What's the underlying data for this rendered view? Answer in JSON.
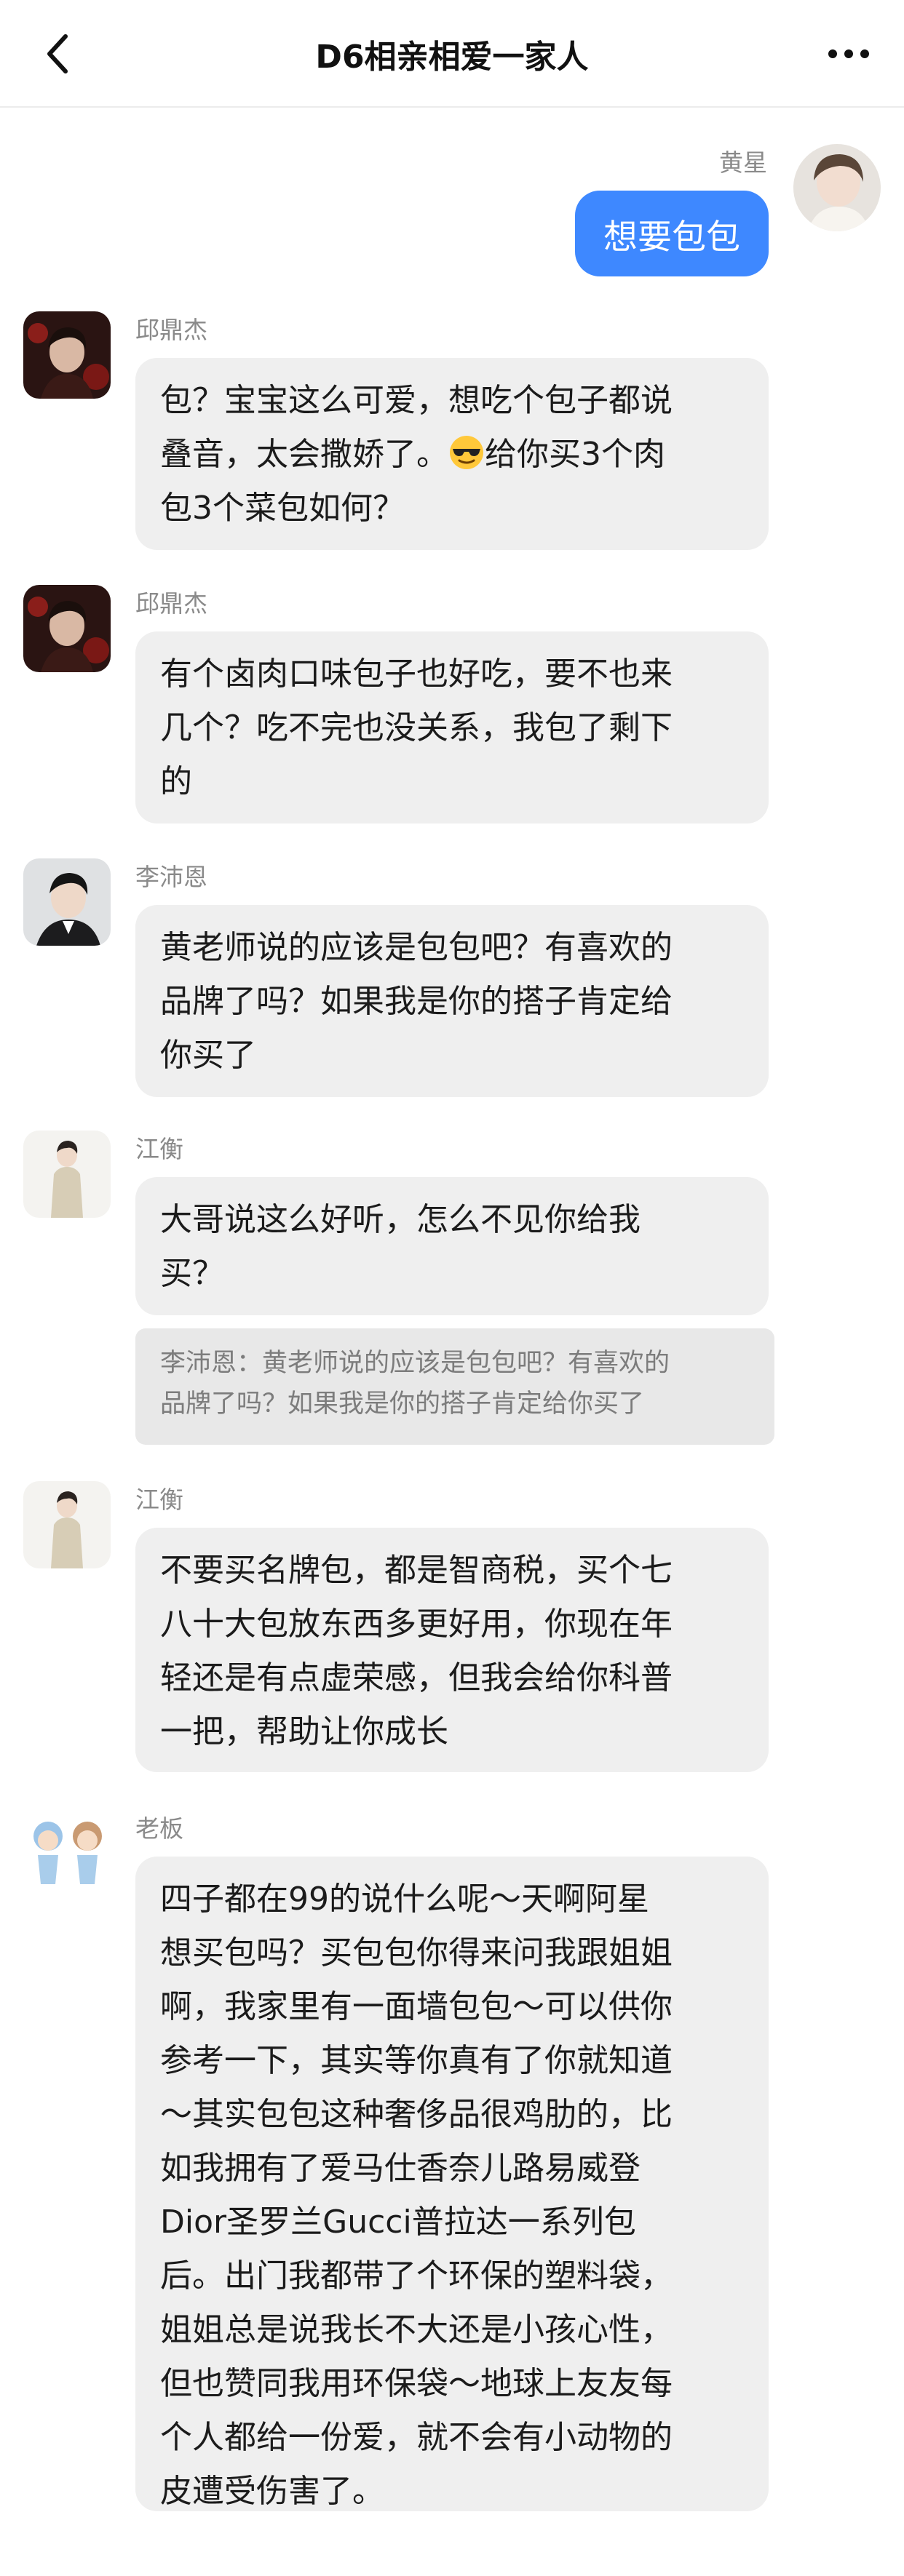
{
  "header": {
    "title": "D6相亲相爱一家人"
  },
  "messages": {
    "self": {
      "name": "黄星",
      "text": "想要包包"
    },
    "m1": {
      "name": "邱鼎杰",
      "lines": [
        "包？宝宝这么可爱，想吃个包子都说",
        "叠音，太会撒娇了。",
        "给你买3个肉",
        "包3个菜包如何？"
      ]
    },
    "m2": {
      "name": "邱鼎杰",
      "lines": [
        "有个卤肉口味包子也好吃，要不也来",
        "几个？吃不完也没关系，我包了剩下",
        "的"
      ]
    },
    "m3": {
      "name": "李沛恩",
      "lines": [
        "黄老师说的应该是包包吧？有喜欢的",
        "品牌了吗？如果我是你的搭子肯定给",
        "你买了"
      ]
    },
    "m4": {
      "name": "江衡",
      "lines": [
        "大哥说这么好听，怎么不见你给我",
        "买？"
      ],
      "quote_lines": [
        "李沛恩：黄老师说的应该是包包吧？有喜欢的",
        "品牌了吗？如果我是你的搭子肯定给你买了"
      ]
    },
    "m5": {
      "name": "江衡",
      "lines": [
        "不要买名牌包，都是智商税，买个七",
        "八十大包放东西多更好用，你现在年",
        "轻还是有点虚荣感，但我会给你科普",
        "一把，帮助让你成长"
      ]
    },
    "m6": {
      "name": "老板",
      "lines": [
        "四子都在99的说什么呢～天啊阿星",
        "想买包吗？买包包你得来问我跟姐姐",
        "啊，我家里有一面墙包包～可以供你",
        "参考一下，其实等你真有了你就知道",
        "～其实包包这种奢侈品很鸡肋的，比",
        "如我拥有了爱马仕香奈儿路易威登",
        "Dior圣罗兰Gucci普拉达一系列包",
        "后。出门我都带了个环保的塑料袋，",
        "姐姐总是说我长不大还是小孩心性，",
        "但也赞同我用环保袋～地球上友友每",
        "个人都给一份爱，就不会有小动物的",
        "皮遭受伤害了。"
      ]
    }
  },
  "icons": {
    "back": "chevron-left-icon",
    "more": "more-dots-icon",
    "emoji": "sunglasses-emoji-icon"
  },
  "colors": {
    "self_bubble": "#3e88ff",
    "other_bubble": "#efefef",
    "quote_bg": "#e8e8e8"
  }
}
